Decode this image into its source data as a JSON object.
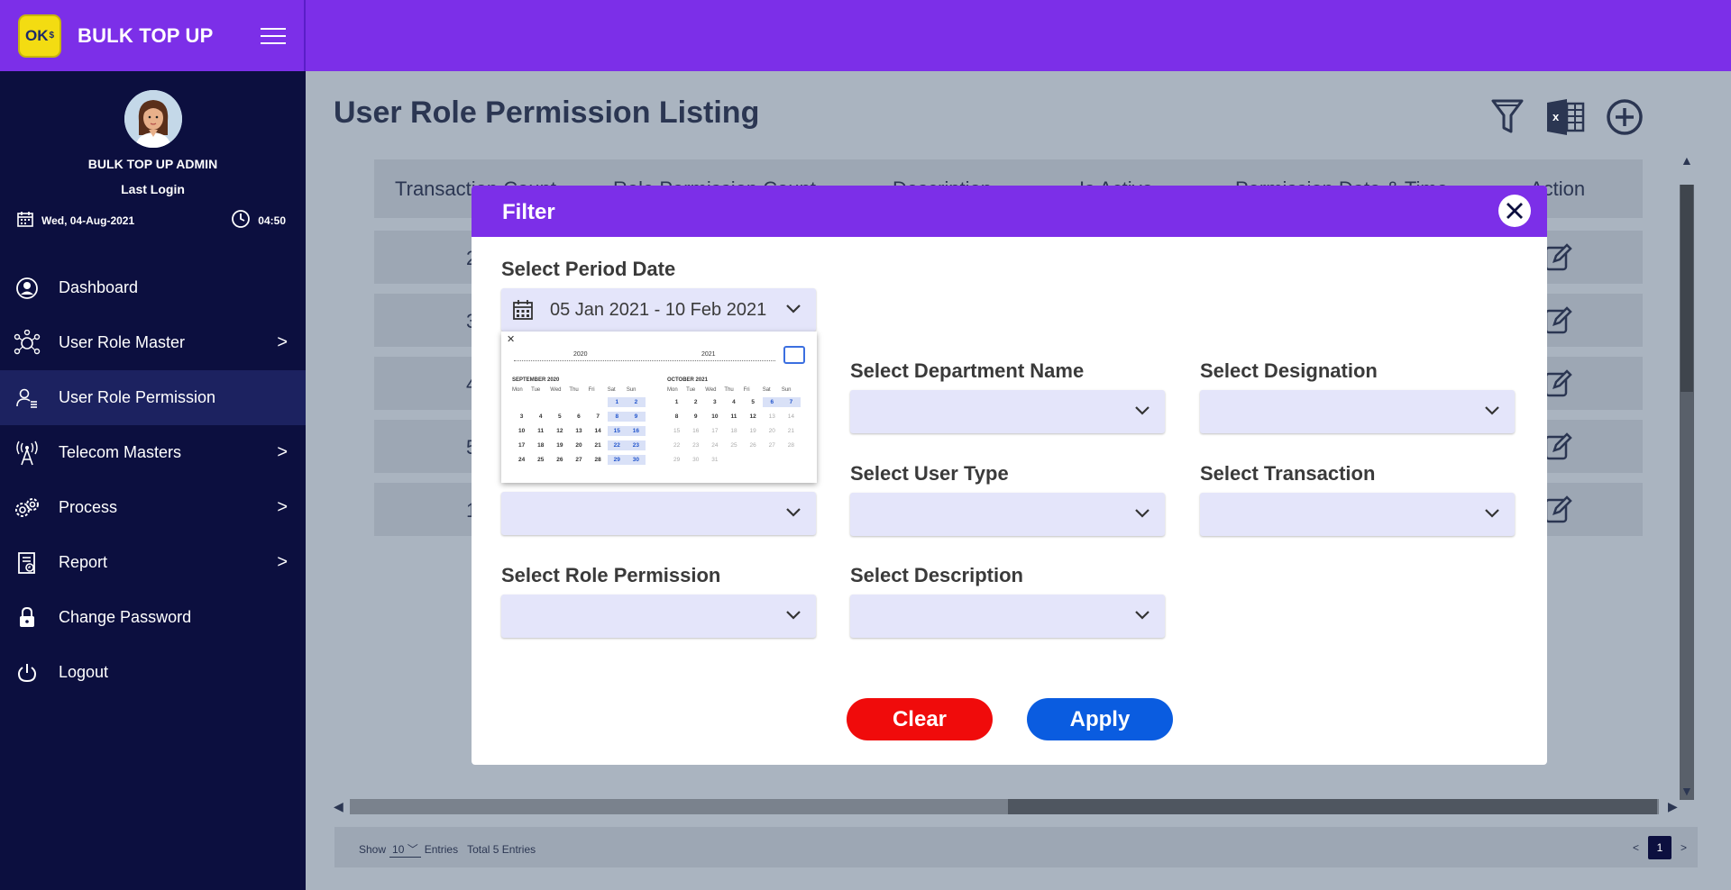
{
  "app": {
    "brand": "BULK TOP UP",
    "logo_text": "OK",
    "logo_sup": "$"
  },
  "profile": {
    "name": "BULK TOP UP ADMIN",
    "last_login_label": "Last Login",
    "date": "Wed, 04-Aug-2021",
    "time": "04:50"
  },
  "nav": {
    "items": [
      {
        "label": "Dashboard",
        "icon": "user-circle-icon",
        "chevron": ""
      },
      {
        "label": "User Role Master",
        "icon": "network-user-icon",
        "chevron": ">"
      },
      {
        "label": "User Role Permission",
        "icon": "user-list-icon",
        "chevron": ""
      },
      {
        "label": "Telecom Masters",
        "icon": "antenna-icon",
        "chevron": ">"
      },
      {
        "label": "Process",
        "icon": "gears-icon",
        "chevron": ">"
      },
      {
        "label": "Report",
        "icon": "report-icon",
        "chevron": ">"
      },
      {
        "label": "Change Password",
        "icon": "lock-icon",
        "chevron": ""
      },
      {
        "label": "Logout",
        "icon": "power-icon",
        "chevron": ""
      }
    ]
  },
  "page": {
    "title": "User Role Permission Listing"
  },
  "table": {
    "headers": [
      "Transaction Count",
      "Role Permission Count",
      "Description",
      "Is Active",
      "Permission Date & Time",
      "Action"
    ],
    "rows": [
      "2",
      "3",
      "4",
      "5",
      "1"
    ]
  },
  "footer": {
    "show_label": "Show",
    "entries_value": "10",
    "entries_label": "Entries",
    "total_label": "Total 5 Entries",
    "page": "1",
    "prev": "<",
    "next": ">"
  },
  "filter": {
    "title": "Filter",
    "period_label": "Select Period Date",
    "period_value": "05 Jan 2021 - 10 Feb 2021",
    "department_label": "Select Department Name",
    "designation_label": "Select Designation",
    "user_type_label": "Select User Type",
    "transaction_label": "Select Transaction",
    "role_permission_label": "Select Role Permission",
    "description_label": "Select Description",
    "clear_label": "Clear",
    "apply_label": "Apply"
  },
  "datepicker": {
    "close": "✕",
    "years": [
      "2020",
      "2021"
    ],
    "dow": [
      "Mon",
      "Tue",
      "Wed",
      "Thu",
      "Fri",
      "Sat",
      "Sun"
    ],
    "months": [
      {
        "title": "SEPTEMBER 2020",
        "offset": 5,
        "days": 30,
        "dim_from": 31
      },
      {
        "title": "OCTOBER 2021",
        "offset": 0,
        "days": 31,
        "dim_from": 13
      }
    ]
  },
  "colors": {
    "accent": "#7c2fe8",
    "sidebar": "#0c0f3f",
    "clear": "#f00b0b",
    "apply": "#0a5ce0"
  }
}
